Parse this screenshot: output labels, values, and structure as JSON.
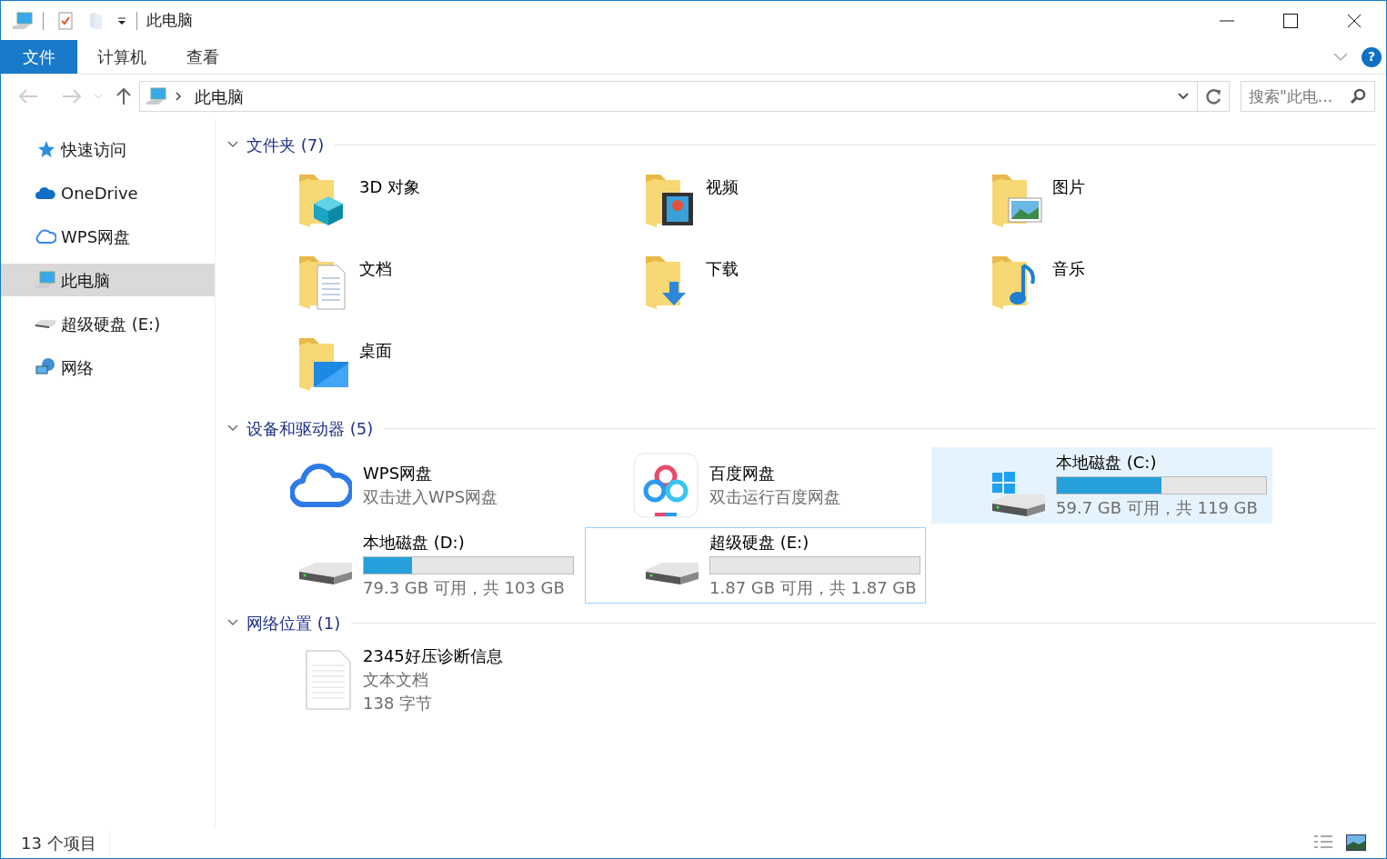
{
  "window": {
    "title": "此电脑"
  },
  "ribbon": {
    "tabs": [
      {
        "label": "文件",
        "selected": true
      },
      {
        "label": "计算机",
        "selected": false
      },
      {
        "label": "查看",
        "selected": false
      }
    ],
    "help": "?"
  },
  "address": {
    "path": "此电脑",
    "search_placeholder": "搜索\"此电..."
  },
  "sidebar": {
    "items": [
      {
        "label": "快速访问",
        "kind": "star",
        "selected": false
      },
      {
        "label": "OneDrive",
        "kind": "onedrive",
        "selected": false
      },
      {
        "label": "WPS网盘",
        "kind": "cloud",
        "selected": false
      },
      {
        "label": "此电脑",
        "kind": "pc",
        "selected": true
      },
      {
        "label": "超级硬盘 (E:)",
        "kind": "drive",
        "selected": false
      },
      {
        "label": "网络",
        "kind": "network",
        "selected": false
      }
    ]
  },
  "groups": [
    {
      "title": "文件夹 (7)",
      "expanded": true,
      "items": [
        {
          "kind": "objects",
          "name": "3D 对象"
        },
        {
          "kind": "videos",
          "name": "视频"
        },
        {
          "kind": "pictures",
          "name": "图片"
        },
        {
          "kind": "documents",
          "name": "文档"
        },
        {
          "kind": "downloads",
          "name": "下载"
        },
        {
          "kind": "music",
          "name": "音乐"
        },
        {
          "kind": "desktop",
          "name": "桌面"
        }
      ]
    },
    {
      "title": "设备和驱动器 (5)",
      "expanded": true,
      "items": [
        {
          "kind": "wps",
          "name": "WPS网盘",
          "subtitle": "双击进入WPS网盘",
          "selected": false,
          "focused": false
        },
        {
          "kind": "baidu",
          "name": "百度网盘",
          "subtitle": "双击运行百度网盘",
          "selected": false,
          "focused": false
        },
        {
          "kind": "systemdrive",
          "name": "本地磁盘 (C:)",
          "level": 0.5,
          "detail": "59.7 GB 可用，共 119 GB",
          "selected": true,
          "focused": false
        },
        {
          "kind": "drive",
          "name": "本地磁盘 (D:)",
          "level": 0.23,
          "detail": "79.3 GB 可用，共 103 GB",
          "selected": false,
          "focused": false
        },
        {
          "kind": "drive",
          "name": "超级硬盘 (E:)",
          "detail": "1.87 GB 可用，共 1.87 GB",
          "selected": false,
          "focused": true
        }
      ]
    },
    {
      "title": "网络位置 (1)",
      "expanded": true,
      "items": [
        {
          "kind": "textfile",
          "name": "2345好压诊断信息",
          "subtitle": "文本文档",
          "detail": "138 字节",
          "selected": false,
          "focused": false
        }
      ]
    }
  ],
  "status_bar": {
    "count": "13 个项目"
  }
}
